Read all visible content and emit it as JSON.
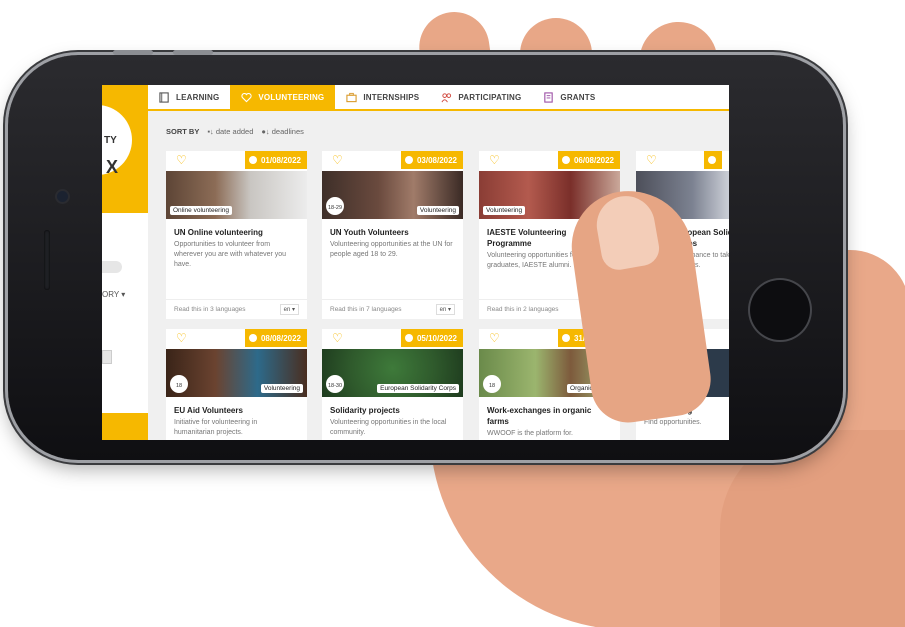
{
  "nav": {
    "items": [
      {
        "label": "LEARNING",
        "icon": "book-icon",
        "active": false
      },
      {
        "label": "VOLUNTEERING",
        "icon": "heart-icon",
        "active": true
      },
      {
        "label": "INTERNSHIPS",
        "icon": "briefcase-icon",
        "active": false
      },
      {
        "label": "PARTICIPATING",
        "icon": "people-icon",
        "active": false
      },
      {
        "label": "GRANTS",
        "icon": "document-icon",
        "active": false
      }
    ]
  },
  "sort": {
    "label": "SORT BY",
    "option1": "date added",
    "option2": "deadlines"
  },
  "left": {
    "logo_text": "TY",
    "category": "ORY"
  },
  "cards": [
    {
      "date": "01/08/2022",
      "tag": "Online volunteering",
      "age": "",
      "title": "UN Online volunteering",
      "desc": "Opportunities to volunteer from wherever you are with whatever you have.",
      "foot": "Read this in 3 languages"
    },
    {
      "date": "03/08/2022",
      "tag": "Volunteering",
      "age": "18-29",
      "title": "UN Youth Volunteers",
      "desc": "Volunteering opportunities at the UN for people aged 18 to 29.",
      "foot": "Read this in 7 languages"
    },
    {
      "date": "06/08/2022",
      "tag": "Volunteering",
      "age": "",
      "title": "IAESTE Volunteering Programme",
      "desc": "Volunteering opportunities for students, graduates, IAESTE alumni.",
      "foot": "Read this in 2 languages"
    },
    {
      "date": "",
      "tag": "",
      "age": "",
      "title": "European Solidarity Corps",
      "desc": "The chance to take part in projects.",
      "foot": ""
    },
    {
      "date": "08/08/2022",
      "tag": "Volunteering",
      "age": "18",
      "title": "EU Aid Volunteers",
      "desc": "Initiative for volunteering in humanitarian projects.",
      "foot": ""
    },
    {
      "date": "05/10/2022",
      "tag": "European Solidarity Corps",
      "age": "18-30",
      "title": "Solidarity projects",
      "desc": "Volunteering opportunities in the local community.",
      "foot": ""
    },
    {
      "date": "31/12/2022",
      "tag": "Organic Farms",
      "age": "18",
      "title": "Work-exchanges in organic farms",
      "desc": "WWOOF is the platform for.",
      "foot": ""
    },
    {
      "date": "",
      "tag": "",
      "age": "",
      "title": "Volunteering",
      "desc": "Find opportunities.",
      "foot": ""
    }
  ],
  "colors": {
    "accent": "#f6b800",
    "background": "#f0f0f0"
  }
}
